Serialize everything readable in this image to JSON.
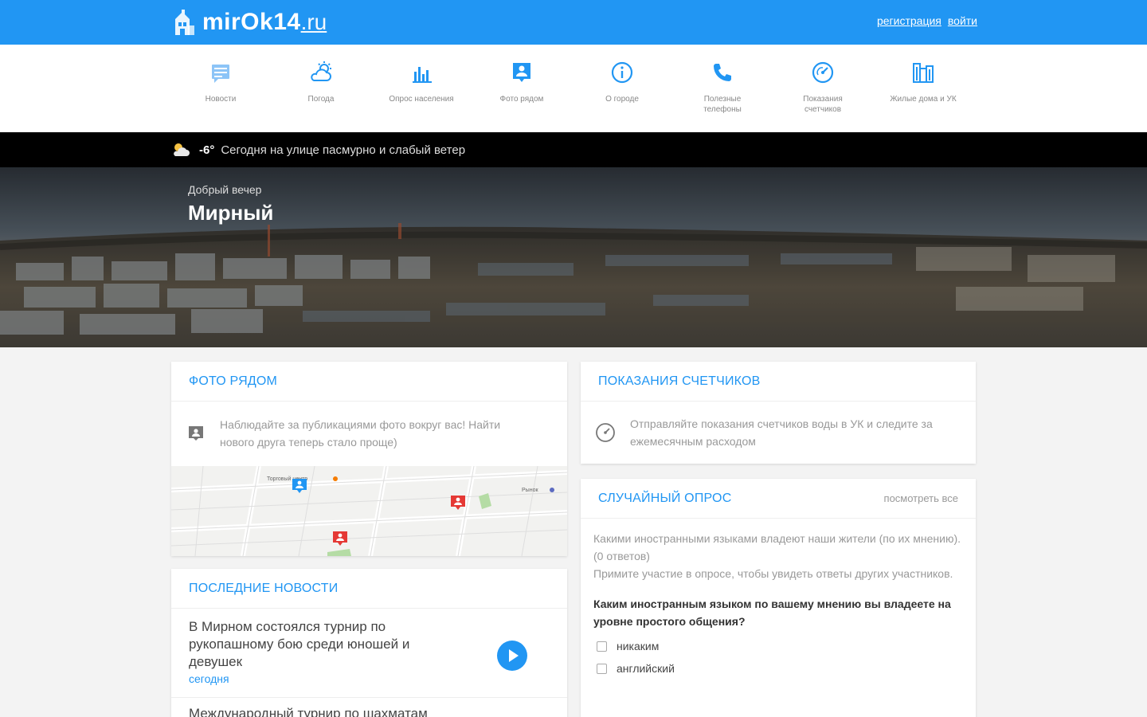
{
  "header": {
    "logo_text": "mirOk14",
    "logo_suffix": ".ru",
    "register_label": "регистрация",
    "login_label": "войти"
  },
  "nav": {
    "items": [
      {
        "label": "Новости",
        "icon": "news-icon"
      },
      {
        "label": "Погода",
        "icon": "weather-icon"
      },
      {
        "label": "Опрос населения",
        "icon": "poll-chart-icon"
      },
      {
        "label": "Фото рядом",
        "icon": "photo-nearby-icon"
      },
      {
        "label": "О городе",
        "icon": "info-icon"
      },
      {
        "label": "Полезные телефоны",
        "icon": "phone-icon"
      },
      {
        "label": "Показания счетчиков",
        "icon": "meter-icon"
      },
      {
        "label": "Жилые дома и УК",
        "icon": "buildings-icon"
      }
    ],
    "accent": "#2196f3"
  },
  "weather": {
    "temperature": "-6°",
    "description": "Сегодня на улице пасмурно и слабый ветер"
  },
  "hero": {
    "greeting": "Добрый вечер",
    "city": "Мирный"
  },
  "photo_card": {
    "title": "ФОТО РЯДОМ",
    "text": "Наблюдайте за публикациями фото вокруг вас! Найти нового друга теперь стало проще)",
    "map_labels": [
      "Торговый центр",
      "Рынок"
    ]
  },
  "meters_card": {
    "title": "ПОКАЗАНИЯ СЧЕТЧИКОВ",
    "text": "Отправляйте показания счетчиков воды в УК и следите за ежемесячным расходом"
  },
  "news_card": {
    "title": "ПОСЛЕДНИЕ НОВОСТИ",
    "items": [
      {
        "title": "В Мирном состоялся турнир по рукопашному бою среди юношей и девушек",
        "date": "сегодня"
      },
      {
        "title": "Международный турнир по шахматам"
      }
    ]
  },
  "poll_card": {
    "title": "СЛУЧАЙНЫЙ ОПРОС",
    "view_all": "посмотреть все",
    "description": "Какими иностранными языками владеют наши жители (по их мнению). (0 ответов)",
    "invite": "Примите участие в опросе, чтобы увидеть ответы других участников.",
    "question": "Каким иностранным языком по вашему мнению вы владеете на уровне простого общения?",
    "options": [
      "никаким",
      "английский"
    ]
  },
  "colors": {
    "primary": "#2196f3",
    "pin": "#e53935",
    "weather_bar": "#000000",
    "page_bg": "#f3f3f3"
  }
}
